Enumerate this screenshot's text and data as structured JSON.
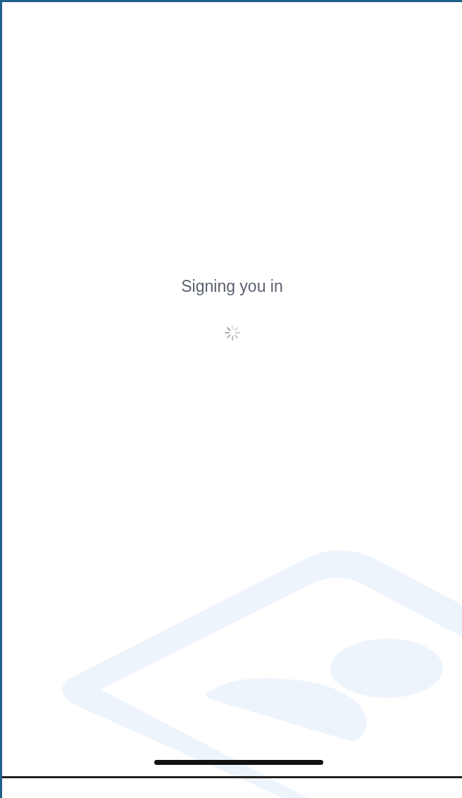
{
  "status": {
    "message": "Signing you in",
    "loading": true
  }
}
